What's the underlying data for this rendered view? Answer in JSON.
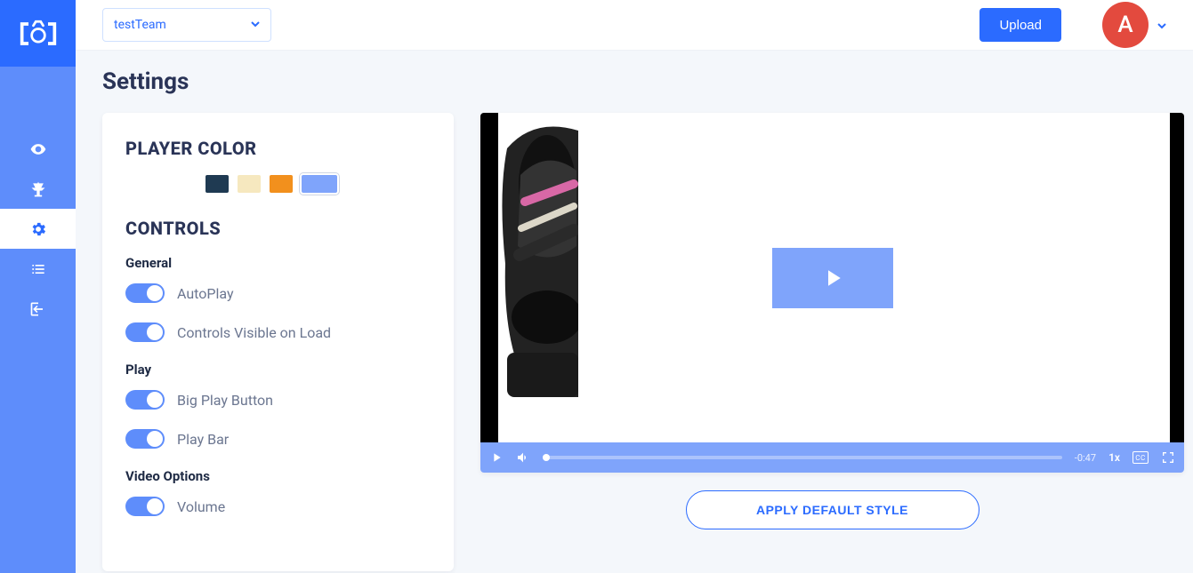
{
  "header": {
    "team": "testTeam",
    "upload": "Upload",
    "avatar_initial": "A"
  },
  "page": {
    "title": "Settings"
  },
  "settings": {
    "player_color": {
      "title": "PLAYER COLOR",
      "swatches": [
        "#1f3a52",
        "#f6e8bf",
        "#f2901d",
        "#7fa4fb"
      ],
      "selected_index": 3
    },
    "controls_title": "CONTROLS",
    "groups": [
      {
        "label": "General",
        "toggles": [
          {
            "label": "AutoPlay",
            "on": true
          },
          {
            "label": "Controls Visible on Load",
            "on": true
          }
        ]
      },
      {
        "label": "Play",
        "toggles": [
          {
            "label": "Big Play Button",
            "on": true
          },
          {
            "label": "Play Bar",
            "on": true
          }
        ]
      },
      {
        "label": "Video Options",
        "toggles": [
          {
            "label": "Volume",
            "on": true
          }
        ]
      }
    ]
  },
  "player": {
    "time_remaining": "-0:47",
    "speed": "1x",
    "cc": "CC"
  },
  "apply_button": "APPLY DEFAULT STYLE"
}
